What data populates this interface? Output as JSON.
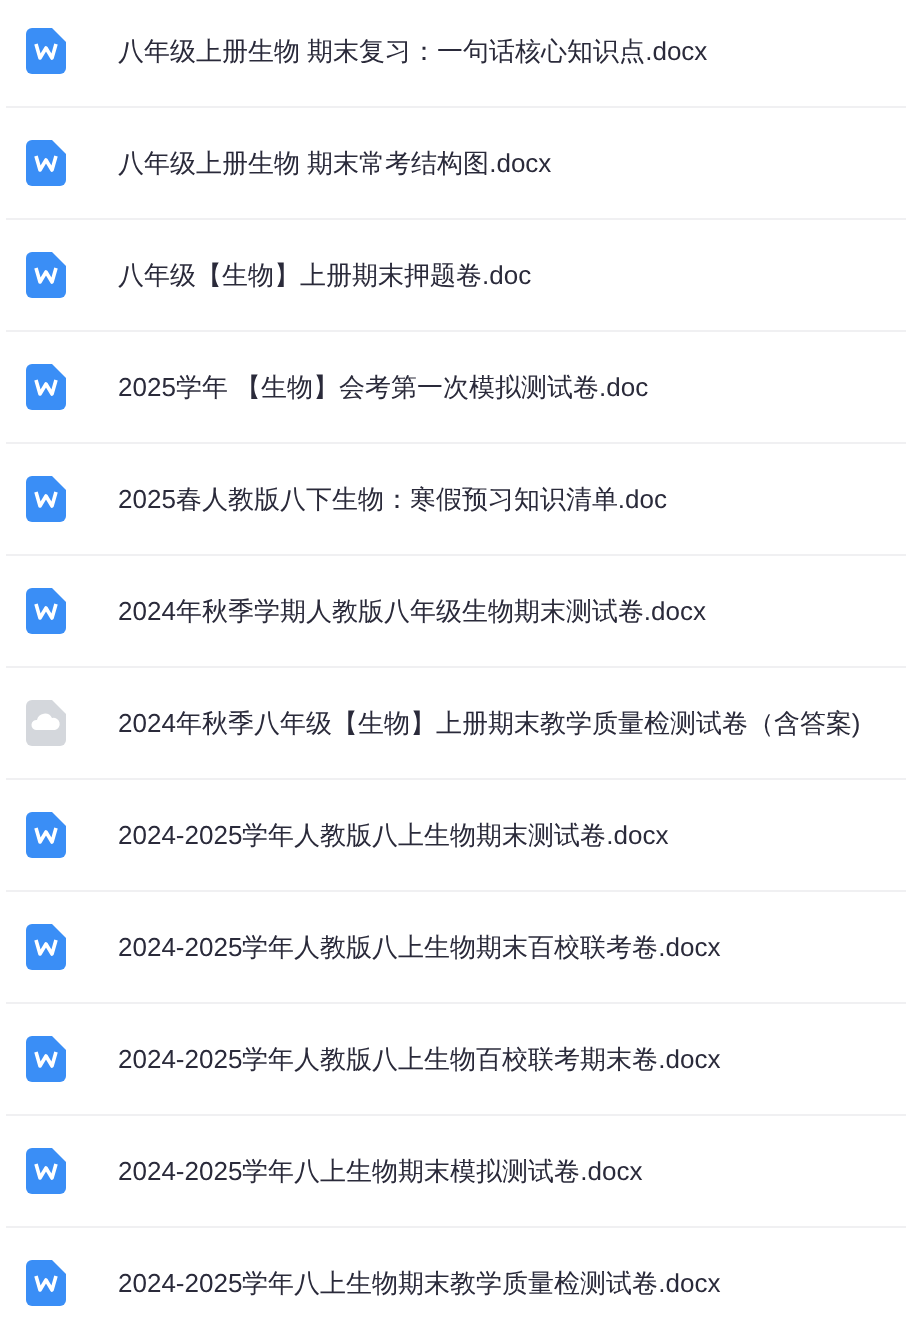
{
  "files": [
    {
      "kind": "word",
      "name": "八年级上册生物 期末复习：一句话核心知识点.docx"
    },
    {
      "kind": "word",
      "name": "八年级上册生物 期末常考结构图.docx"
    },
    {
      "kind": "word",
      "name": "八年级【生物】上册期末押题卷.doc"
    },
    {
      "kind": "word",
      "name": "2025学年 【生物】会考第一次模拟测试卷.doc"
    },
    {
      "kind": "word",
      "name": "2025春人教版八下生物：寒假预习知识清单.doc"
    },
    {
      "kind": "word",
      "name": "2024年秋季学期人教版八年级生物期末测试卷.docx"
    },
    {
      "kind": "cloud",
      "name": "2024年秋季八年级【生物】上册期末教学质量检测试卷（含答案)"
    },
    {
      "kind": "word",
      "name": "2024-2025学年人教版八上生物期末测试卷.docx"
    },
    {
      "kind": "word",
      "name": "2024-2025学年人教版八上生物期末百校联考卷.docx"
    },
    {
      "kind": "word",
      "name": "2024-2025学年人教版八上生物百校联考期末卷.docx"
    },
    {
      "kind": "word",
      "name": "2024-2025学年八上生物期末模拟测试卷.docx"
    },
    {
      "kind": "word",
      "name": "2024-2025学年八上生物期末教学质量检测试卷.docx"
    }
  ]
}
